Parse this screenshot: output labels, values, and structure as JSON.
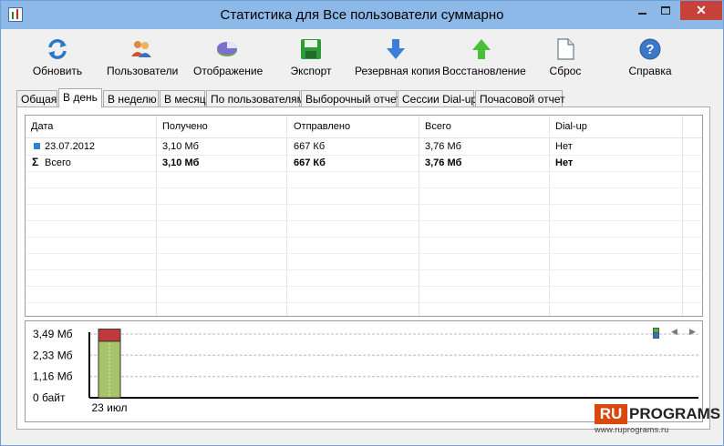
{
  "window": {
    "title": "Статистика для Все пользователи суммарно"
  },
  "toolbar": {
    "buttons": [
      {
        "label": "Обновить",
        "icon": "refresh-icon"
      },
      {
        "label": "Пользователи",
        "icon": "users-icon"
      },
      {
        "label": "Отображение",
        "icon": "display-icon"
      },
      {
        "label": "Экспорт",
        "icon": "floppy-disk-icon"
      },
      {
        "label": "Резервная копия",
        "icon": "arrow-down-icon"
      },
      {
        "label": "Восстановление",
        "icon": "arrow-up-icon"
      },
      {
        "label": "Сброс",
        "icon": "blank-page-icon"
      },
      {
        "label": "Справка",
        "icon": "help-icon"
      }
    ]
  },
  "tabs": [
    {
      "label": "Общая"
    },
    {
      "label": "В день",
      "active": true
    },
    {
      "label": "В неделю"
    },
    {
      "label": "В месяц"
    },
    {
      "label": "По пользователям"
    },
    {
      "label": "Выборочный отчет"
    },
    {
      "label": "Сессии Dial-up"
    },
    {
      "label": "Почасовой отчет"
    }
  ],
  "table": {
    "columns": [
      "Дата",
      "Получено",
      "Отправлено",
      "Всего",
      "Dial-up"
    ],
    "rows": [
      {
        "date": "23.07.2012",
        "received": "3,10 Мб",
        "sent": "667 Кб",
        "total": "3,76 Мб",
        "dialup": "Нет"
      }
    ],
    "summary": {
      "symbol": "Σ",
      "date": "Всего",
      "received": "3,10 Мб",
      "sent": "667 Кб",
      "total": "3,76 Мб",
      "dialup": "Нет"
    }
  },
  "chart_data": {
    "type": "bar",
    "categories": [
      "23 июл"
    ],
    "series": [
      {
        "values": [
          3.1
        ],
        "color": "#a8c46a"
      },
      {
        "values": [
          0.66
        ],
        "color": "#c0393b"
      }
    ],
    "ytick_labels": [
      "3,49 Мб",
      "2,33 Мб",
      "1,16 Мб",
      "0 байт"
    ],
    "ytick_values": [
      3.49,
      2.33,
      1.16,
      0
    ],
    "ylim": [
      0,
      3.49
    ],
    "grid": true,
    "stacked": true,
    "legend_colors": [
      "#3bbf3b",
      "#2f6fd0"
    ]
  },
  "watermark": {
    "ru": "RU",
    "programs": "PROGRAMS",
    "url": "www.ruprograms.ru"
  }
}
